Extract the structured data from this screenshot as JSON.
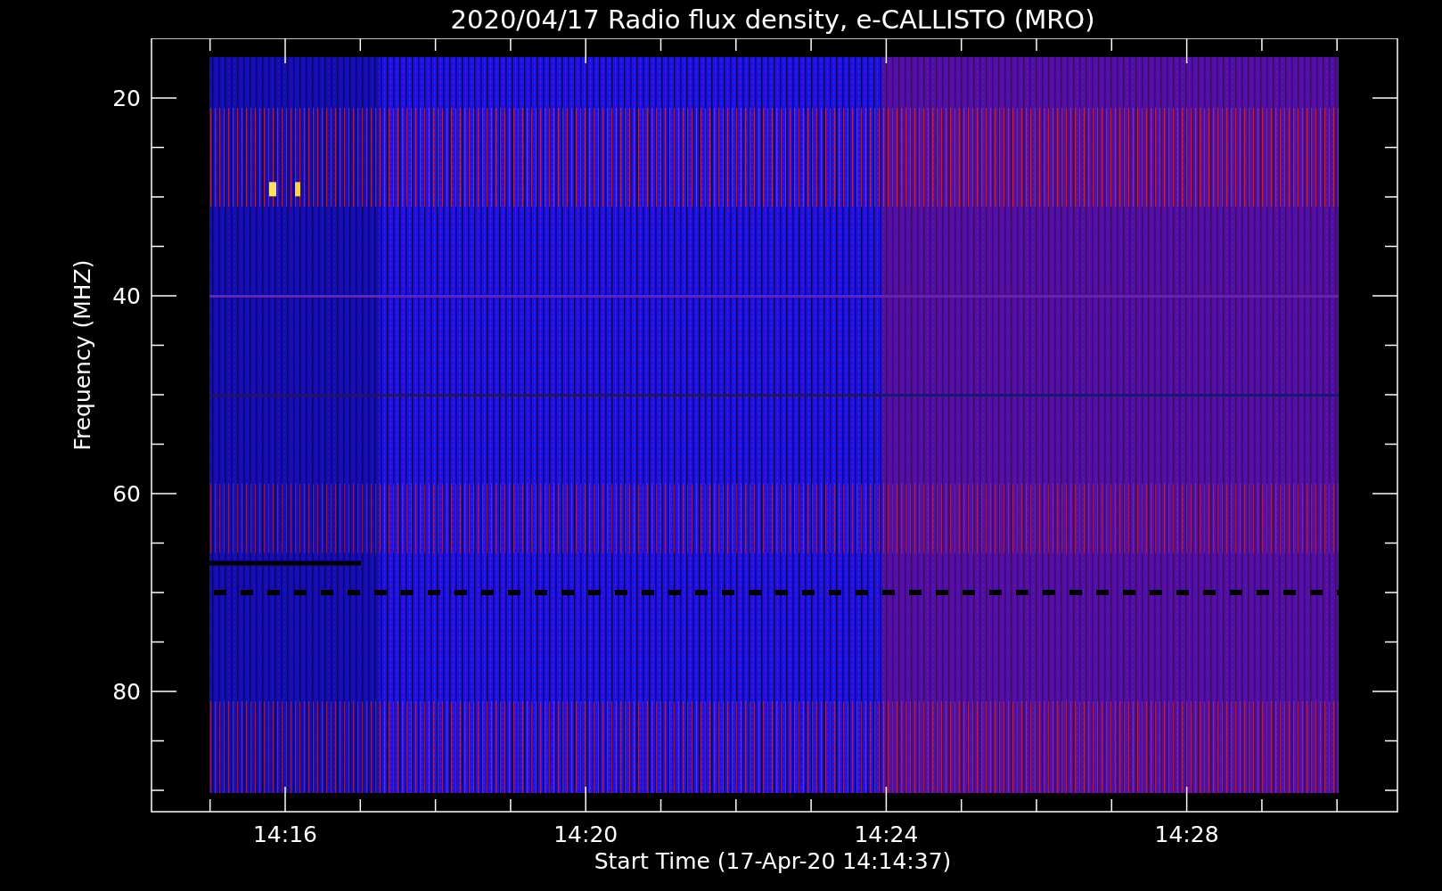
{
  "plot": {
    "title": "2020/04/17  Radio flux density, e-CALLISTO (MRO)",
    "x_axis": {
      "label": "Start Time (17-Apr-20 14:14:37)",
      "ticks": [
        "14:16",
        "14:20",
        "14:24",
        "14:28"
      ]
    },
    "y_axis": {
      "label": "Frequency (MHZ)",
      "ticks": [
        "20",
        "40",
        "60",
        "80"
      ]
    }
  }
}
